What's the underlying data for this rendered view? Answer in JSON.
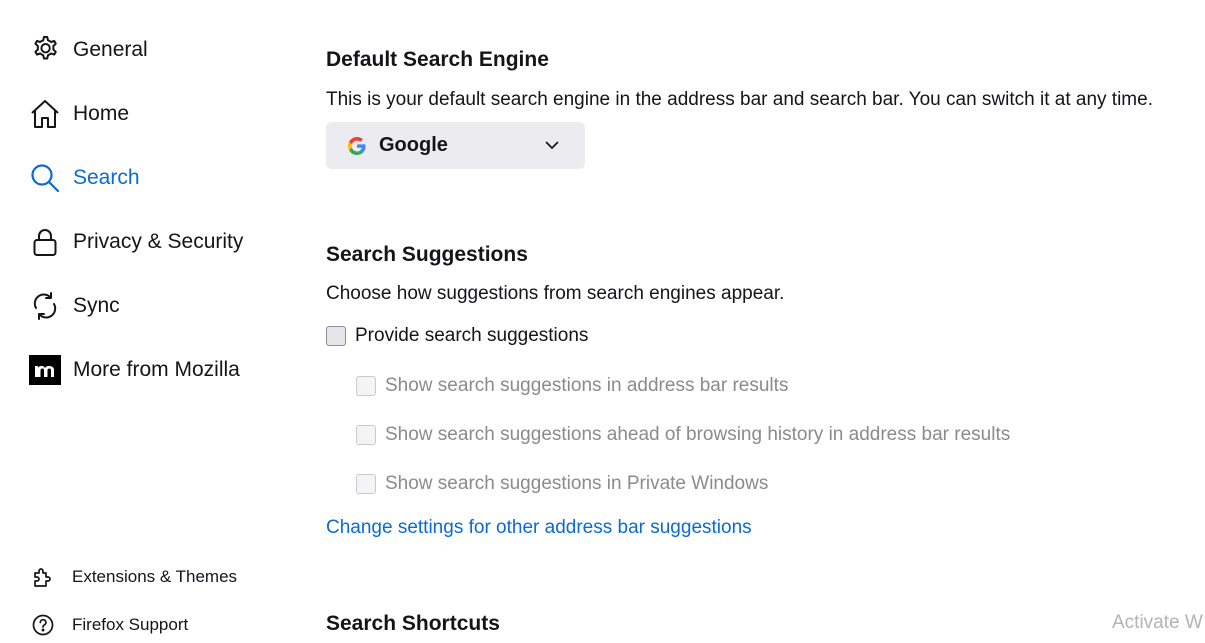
{
  "sidebar": {
    "items": [
      {
        "label": "General",
        "icon": "gear-icon"
      },
      {
        "label": "Home",
        "icon": "home-icon"
      },
      {
        "label": "Search",
        "icon": "search-icon",
        "active": true
      },
      {
        "label": "Privacy & Security",
        "icon": "lock-icon"
      },
      {
        "label": "Sync",
        "icon": "sync-icon"
      },
      {
        "label": "More from Mozilla",
        "icon": "mozilla-logo-icon"
      }
    ],
    "footer": [
      {
        "label": "Extensions & Themes",
        "icon": "puzzle-icon"
      },
      {
        "label": "Firefox Support",
        "icon": "help-icon"
      }
    ]
  },
  "default_engine": {
    "heading": "Default Search Engine",
    "description": "This is your default search engine in the address bar and search bar. You can switch it at any time.",
    "selected": "Google",
    "icon": "google-icon"
  },
  "suggestions": {
    "heading": "Search Suggestions",
    "description": "Choose how suggestions from search engines appear.",
    "provide_label": "Provide search suggestions",
    "provide_checked": false,
    "sub_options": [
      {
        "label": "Show search suggestions in address bar results",
        "checked": false,
        "disabled": true
      },
      {
        "label": "Show search suggestions ahead of browsing history in address bar results",
        "checked": false,
        "disabled": true
      },
      {
        "label": "Show search suggestions in Private Windows",
        "checked": false,
        "disabled": true
      }
    ],
    "link": "Change settings for other address bar suggestions"
  },
  "shortcuts": {
    "heading": "Search Shortcuts"
  },
  "watermark": "Activate W",
  "colors": {
    "accent": "#0b6bd0",
    "text": "#15141a",
    "disabled_text": "#8a8a91",
    "select_bg": "#ececf0"
  }
}
